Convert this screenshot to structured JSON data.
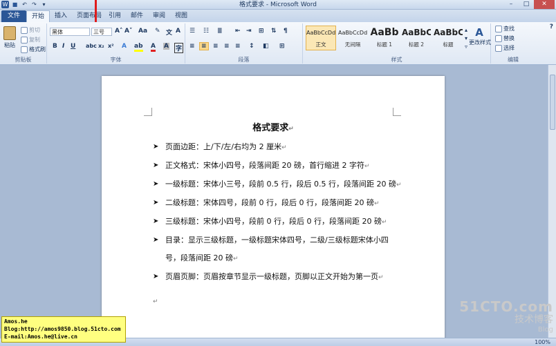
{
  "window": {
    "title": "格式要求 - Microsoft Word"
  },
  "tabs": [
    "文件",
    "开始",
    "插入",
    "页面布局",
    "引用",
    "邮件",
    "审阅",
    "视图"
  ],
  "ribbon": {
    "clipboard": {
      "paste": "粘贴",
      "cut": "剪切",
      "copy": "复制",
      "format_painter": "格式刷",
      "label": "剪贴板"
    },
    "font": {
      "name": "黑体",
      "size": "三号",
      "label": "字体"
    },
    "paragraph": {
      "label": "段落"
    },
    "styles": {
      "items": [
        {
          "preview": "AaBbCcDd",
          "name": "正文",
          "selected": true
        },
        {
          "preview": "AaBbCcDd",
          "name": "无间隔"
        },
        {
          "preview": "AaBb",
          "name": "标题 1"
        },
        {
          "preview": "AaBbC",
          "name": "标题 2"
        },
        {
          "preview": "AaBbC",
          "name": "标题"
        }
      ],
      "change_styles": "更改样式",
      "label": "样式"
    },
    "editing": {
      "find": "查找",
      "replace": "替换",
      "select": "选择",
      "label": "编辑"
    }
  },
  "document": {
    "title": "格式要求",
    "items": [
      "页面边距：上/下/左/右均为 2 厘米",
      "正文格式：宋体小四号，段落间距 20 磅，首行缩进 2 字符",
      "一级标题：宋体小三号，段前 0.5 行，段后 0.5 行，段落间距 20 磅",
      "二级标题：宋体四号，段前 0 行，段后 0 行，段落间距 20 磅",
      "三级标题：宋体小四号，段前 0 行，段后 0 行，段落间距 20 磅",
      "目录：显示三级标题，一级标题宋体四号，二级/三级标题宋体小四号，段落间距 20 磅",
      "页眉页脚：页眉按章节显示一级标题，页脚以正文开始为第一页"
    ]
  },
  "signature": {
    "line1": "Amos.he",
    "line2": "Blog:http://amos9850.blog.51cto.com",
    "line3": "E-mail:Amos.he@live.cn"
  },
  "watermark": {
    "line1": "51CTO.com",
    "line2": "技术博客",
    "line3": "Blog"
  },
  "statusbar": {
    "zoom": "100%"
  },
  "colors": {
    "file_tab": "#2b5797",
    "highlight_box": "#e01b1b",
    "selected_style": "#fbe7b5"
  }
}
